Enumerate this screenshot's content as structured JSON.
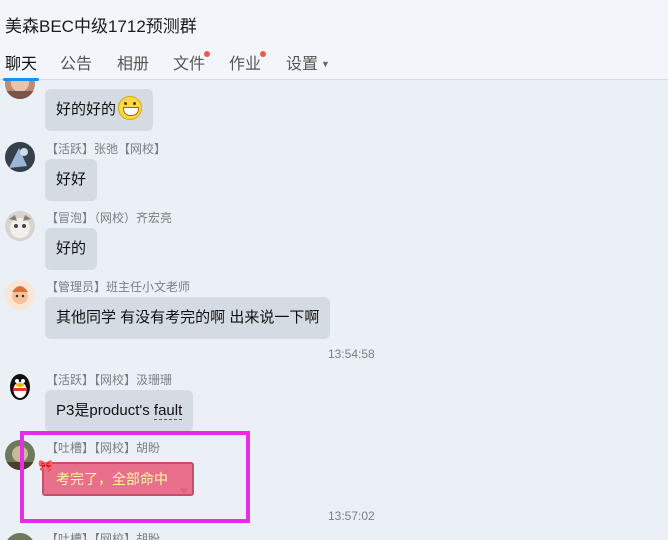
{
  "window": {
    "title": "美森BEC中级1712预测群"
  },
  "tabs": [
    {
      "label": "聊天",
      "active": true
    },
    {
      "label": "公告"
    },
    {
      "label": "相册"
    },
    {
      "label": "文件",
      "dot": true
    },
    {
      "label": "作业",
      "dot": true
    },
    {
      "label": "设置"
    }
  ],
  "messages": [
    {
      "text": "好的好的",
      "emoji": "grin-emoji"
    },
    {
      "sender": "【活跃】张弛【网校】",
      "text": "好好"
    },
    {
      "sender": "【冒泡】（网校）齐宏亮",
      "text": "好的"
    },
    {
      "sender": "【管理员】班主任小文老师",
      "text": "其他同学 有没有考完的啊 出来说一下啊"
    },
    {
      "time": "13:54:58"
    },
    {
      "sender": "【活跃】【网校】汲珊珊",
      "text_prefix": "P3是product's ",
      "text_fault": "fault"
    },
    {
      "sender": "【吐槽】【网校】胡盼",
      "text": "考完了，全部命中"
    },
    {
      "time": "13:57:02"
    },
    {
      "sender": "【吐槽】【网校】胡盼"
    }
  ],
  "colors": {
    "accent": "#1e8ee6",
    "highlight": "#e62ee3",
    "bubble": "#d4dbe3",
    "card": "#e9708c"
  }
}
